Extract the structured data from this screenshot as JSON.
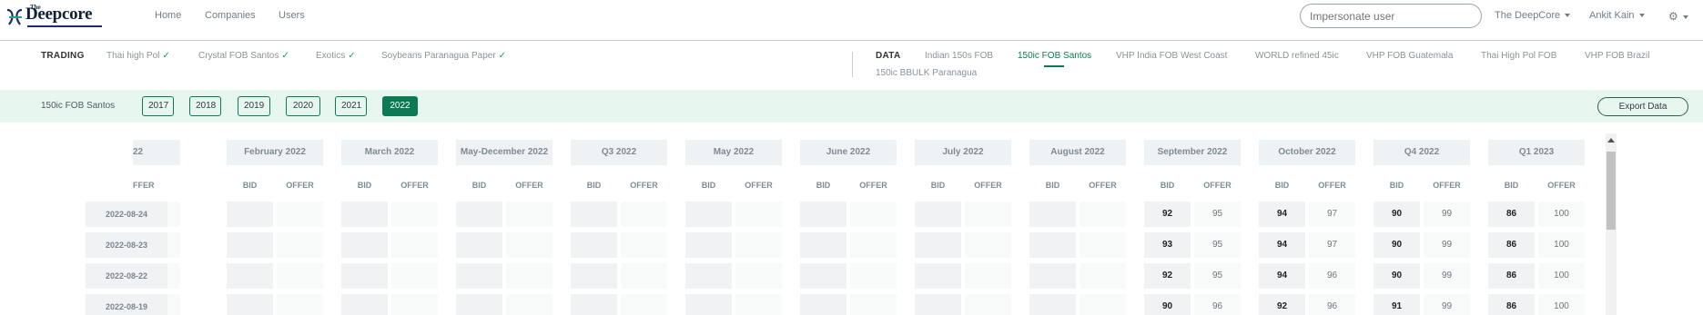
{
  "header": {
    "logo": {
      "the": "The",
      "name": "Deepcore"
    },
    "nav": [
      "Home",
      "Companies",
      "Users"
    ],
    "impersonate_placeholder": "Impersonate user",
    "org_menu": "The DeepCore",
    "user_menu": "Ankit Kain"
  },
  "trading": {
    "label": "TRADING",
    "items": [
      "Thai high Pol",
      "Crystal FOB Santos",
      "Exotics",
      "Soybeans Paranagua Paper"
    ]
  },
  "data_nav": {
    "label": "DATA",
    "items": [
      "Indian 150s FOB",
      "150ic FOB Santos",
      "VHP India FOB West Coast",
      "WORLD refined 45ic",
      "VHP FOB Guatemala",
      "Thai High Pol FOB",
      "VHP FOB Brazil",
      "150ic BBULK Paranagua"
    ],
    "active": "150ic FOB Santos"
  },
  "yearbar": {
    "title": "150ic FOB Santos",
    "years": [
      "2017",
      "2018",
      "2019",
      "2020",
      "2021",
      "2022"
    ],
    "active_year": "2022",
    "export_label": "Export Data"
  },
  "grid": {
    "columns": [
      "22",
      "February 2022",
      "March 2022",
      "May-December 2022",
      "Q3 2022",
      "May 2022",
      "June 2022",
      "July 2022",
      "August 2022",
      "September 2022",
      "October 2022",
      "Q4 2022",
      "Q1 2023"
    ],
    "bid_label": "BID",
    "offer_label": "OFFER",
    "first_offer_label": "FFER",
    "dates": [
      "2022-08-24",
      "2022-08-23",
      "2022-08-22",
      "2022-08-19"
    ],
    "values": {
      "September 2022": [
        [
          "92",
          "95"
        ],
        [
          "93",
          "95"
        ],
        [
          "92",
          "95"
        ],
        [
          "90",
          "96"
        ]
      ],
      "October 2022": [
        [
          "94",
          "97"
        ],
        [
          "94",
          "97"
        ],
        [
          "94",
          "96"
        ],
        [
          "92",
          "96"
        ]
      ],
      "Q4 2022": [
        [
          "90",
          "99"
        ],
        [
          "90",
          "99"
        ],
        [
          "90",
          "99"
        ],
        [
          "91",
          "99"
        ]
      ],
      "Q1 2023": [
        [
          "86",
          "100"
        ],
        [
          "86",
          "100"
        ],
        [
          "86",
          "100"
        ],
        [
          "86",
          "100"
        ]
      ]
    }
  },
  "colors": {
    "accent": "#0b7a55",
    "yearbar_bg": "#e7f7f0"
  }
}
